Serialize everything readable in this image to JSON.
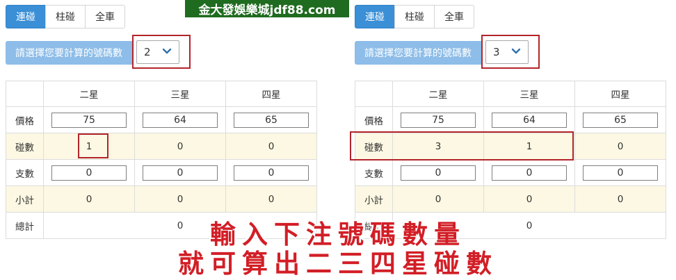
{
  "banner": "金大發娛樂城jdf88.com",
  "left": {
    "tabs": [
      {
        "label": "連碰",
        "active": true
      },
      {
        "label": "柱碰",
        "active": false
      },
      {
        "label": "全車",
        "active": false
      }
    ],
    "select_label": "請選擇您要計算的號碼數",
    "select_value": "2",
    "headers": [
      "",
      "二星",
      "三星",
      "四星"
    ],
    "rows": {
      "price": {
        "label": "價格",
        "values": [
          "75",
          "64",
          "65"
        ]
      },
      "hits": {
        "label": "碰數",
        "values": [
          "1",
          "0",
          "0"
        ]
      },
      "count": {
        "label": "支數",
        "values": [
          "0",
          "0",
          "0"
        ]
      },
      "subtotal": {
        "label": "小計",
        "values": [
          "0",
          "0",
          "0"
        ]
      },
      "total": {
        "label": "總計",
        "value": "0"
      }
    }
  },
  "right": {
    "tabs": [
      {
        "label": "連碰",
        "active": true
      },
      {
        "label": "柱碰",
        "active": false
      },
      {
        "label": "全車",
        "active": false
      }
    ],
    "select_label": "請選擇您要計算的號碼數",
    "select_value": "3",
    "headers": [
      "",
      "二星",
      "三星",
      "四星"
    ],
    "rows": {
      "price": {
        "label": "價格",
        "values": [
          "75",
          "64",
          "65"
        ]
      },
      "hits": {
        "label": "碰數",
        "values": [
          "3",
          "1",
          "0"
        ]
      },
      "count": {
        "label": "支數",
        "values": [
          "0",
          "0",
          "0"
        ]
      },
      "subtotal": {
        "label": "小計",
        "values": [
          "0",
          "0",
          "0"
        ]
      },
      "total": {
        "label": "總計",
        "value": "0"
      }
    }
  },
  "overlay": {
    "line1": "輸入下注號碼數量",
    "line2": "就可算出二三四星碰數"
  },
  "colors": {
    "tab_active": "#3a8fd6",
    "label_bg": "#8dbde8",
    "row_alt": "#fcf8e3",
    "highlight": "#b3242b",
    "overlay_text": "#d21e26",
    "banner_bg": "#1f6b1f"
  }
}
